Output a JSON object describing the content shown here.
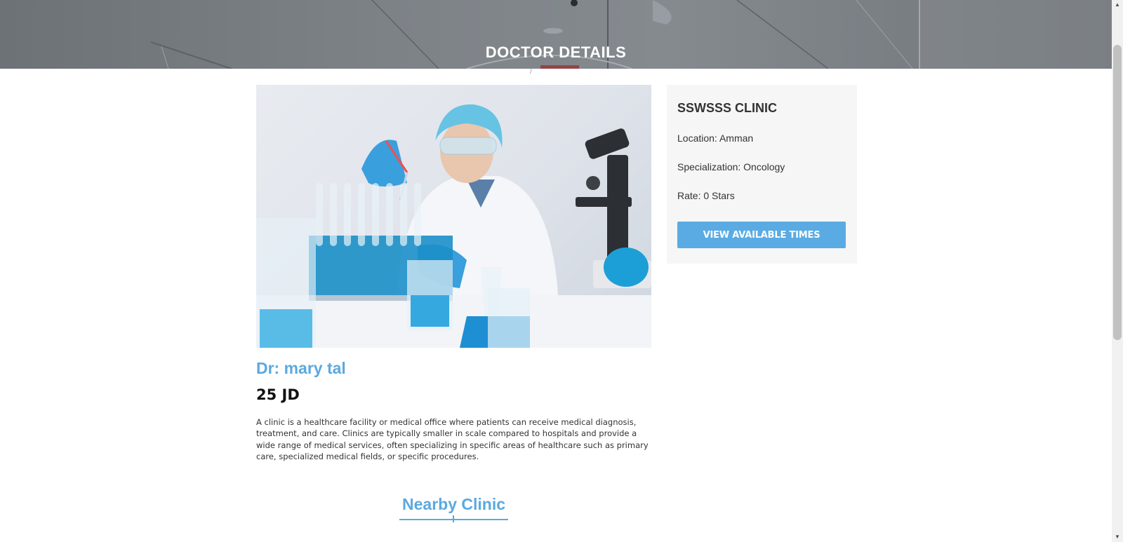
{
  "hero": {
    "title": "DOCTOR DETAILS",
    "breadcrumb_separator": "/"
  },
  "doctor": {
    "name": "Dr: mary tal",
    "price": "25 JD",
    "description": "A clinic is a healthcare facility or medical office where patients can receive medical diagnosis, treatment, and care. Clinics are typically smaller in scale compared to hospitals and provide a wide range of medical services, often specializing in specific areas of healthcare such as primary care, specialized medical fields, or specific procedures."
  },
  "clinic": {
    "name": "SSWSSS CLINIC",
    "location": "Location: Amman",
    "specialization": "Specialization: Oncology",
    "rate": "Rate: 0 Stars",
    "button_label": "VIEW AVAILABLE TIMES"
  },
  "nearby": {
    "title": "Nearby Clinic"
  },
  "colors": {
    "accent": "#5aabe3",
    "card_bg": "#f6f6f6",
    "text": "#333333"
  },
  "scrollbar": {
    "up_arrow": "▲",
    "down_arrow": "▼"
  }
}
